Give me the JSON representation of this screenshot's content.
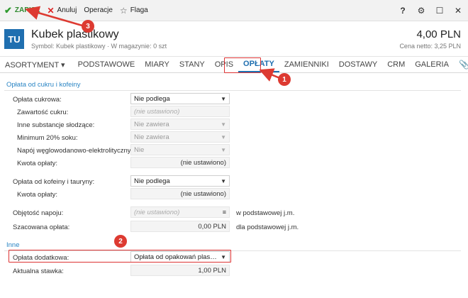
{
  "toolbar": {
    "save_label": "ZAPISZ",
    "cancel_label": "Anuluj",
    "operations_label": "Operacje",
    "flag_label": "Flaga",
    "help_glyph": "?"
  },
  "header": {
    "avatar_text": "TU",
    "title": "Kubek plastikowy",
    "subtitle": "Symbol: Kubek plastikowy  ·  W magazynie: 0 szt",
    "price": "4,00 PLN",
    "price_net": "Cena netto: 3,25 PLN"
  },
  "tabs": [
    {
      "label": "ASORTYMENT ▾",
      "active": false
    },
    {
      "label": "PODSTAWOWE",
      "active": false
    },
    {
      "label": "MIARY",
      "active": false
    },
    {
      "label": "STANY",
      "active": false
    },
    {
      "label": "OPIS",
      "active": false
    },
    {
      "label": "OPŁATY",
      "active": true
    },
    {
      "label": "ZAMIENNIKI",
      "active": false
    },
    {
      "label": "DOSTAWY",
      "active": false
    },
    {
      "label": "CRM",
      "active": false
    },
    {
      "label": "GALERIA",
      "active": false
    }
  ],
  "sections": {
    "sugar_caffeine": "Opłata od cukru i kofeiny",
    "other": "Inne"
  },
  "fields": {
    "sugar_fee": {
      "label": "Opłata cukrowa:",
      "value": "Nie podlega"
    },
    "sugar_content": {
      "label": "Zawartość cukru:",
      "placeholder": "(nie ustawiono)"
    },
    "other_sweeteners": {
      "label": "Inne substancje słodzące:",
      "value": "Nie zawiera"
    },
    "min_juice": {
      "label": "Minimum 20% soku:",
      "value": "Nie zawiera"
    },
    "isotonic": {
      "label": "Napój węglowodanowo-elektrolityczny:",
      "value": "Nie"
    },
    "fee_amount_1": {
      "label": "Kwota opłaty:",
      "value": "(nie ustawiono)"
    },
    "caffeine_fee": {
      "label": "Opłata od kofeiny i tauryny:",
      "value": "Nie podlega"
    },
    "fee_amount_2": {
      "label": "Kwota opłaty:",
      "value": "(nie ustawiono)"
    },
    "volume": {
      "label": "Objętość napoju:",
      "placeholder": "(nie ustawiono)",
      "unit": "w podstawowej j.m."
    },
    "estimated_fee": {
      "label": "Szacowana opłata:",
      "value": "0,00 PLN",
      "unit": "dla podstawowej j.m."
    },
    "additional_fee": {
      "label": "Opłata dodatkowa:",
      "value": "Opłata od opakowań plastiko..."
    },
    "current_rate": {
      "label": "Aktualna stawka:",
      "value": "1,00 PLN"
    }
  },
  "annotations": [
    "1",
    "2",
    "3"
  ],
  "colors": {
    "accent": "#1f6fb0",
    "annotation": "#dd3a31",
    "section": "#2a85c4",
    "save": "#2f8a2f"
  }
}
